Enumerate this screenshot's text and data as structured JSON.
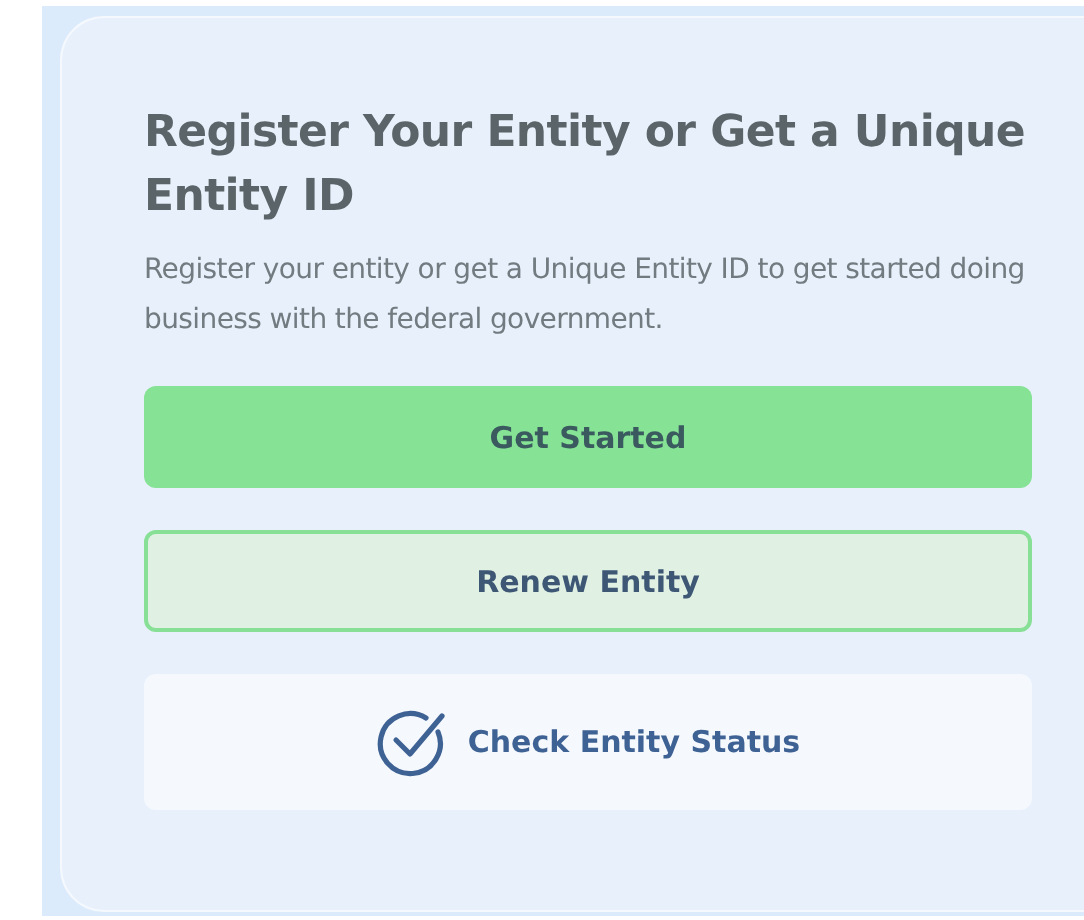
{
  "card": {
    "title": "Register Your Entity or Get a Unique Entity ID",
    "description": "Register your entity or get a Unique Entity ID to get started doing business with the federal government.",
    "buttons": [
      {
        "kind": "primary",
        "label": "Get Started"
      },
      {
        "kind": "outline",
        "label": "Renew Entity"
      },
      {
        "kind": "status",
        "label": "Check Entity Status"
      }
    ]
  }
}
